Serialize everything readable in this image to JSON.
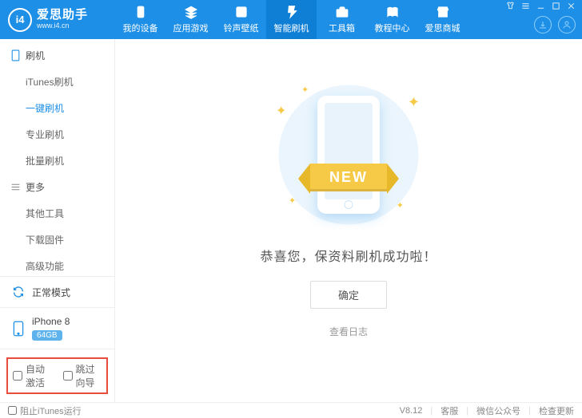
{
  "brand": {
    "name": "爱思助手",
    "site": "www.i4.cn",
    "logo_text": "i4"
  },
  "nav": [
    {
      "label": "我的设备",
      "icon": "device"
    },
    {
      "label": "应用游戏",
      "icon": "apps"
    },
    {
      "label": "铃声壁纸",
      "icon": "ring"
    },
    {
      "label": "智能刷机",
      "icon": "flash",
      "active": true
    },
    {
      "label": "工具箱",
      "icon": "toolbox"
    },
    {
      "label": "教程中心",
      "icon": "book"
    },
    {
      "label": "爱思商城",
      "icon": "store"
    }
  ],
  "sidebar": {
    "groups": [
      {
        "title": "刷机",
        "icon": "phone",
        "items": [
          {
            "label": "iTunes刷机"
          },
          {
            "label": "一键刷机",
            "active": true
          },
          {
            "label": "专业刷机"
          },
          {
            "label": "批量刷机"
          }
        ]
      },
      {
        "title": "更多",
        "icon": "menu",
        "items": [
          {
            "label": "其他工具"
          },
          {
            "label": "下载固件"
          },
          {
            "label": "高级功能"
          }
        ]
      }
    ]
  },
  "mode": {
    "label": "正常模式"
  },
  "device": {
    "name": "iPhone 8",
    "storage": "64GB"
  },
  "bottom_checks": {
    "auto_activate": "自动激活",
    "skip_setup": "跳过向导"
  },
  "main": {
    "ribbon_text": "NEW",
    "success_message": "恭喜您，保资料刷机成功啦！",
    "confirm": "确定",
    "view_log": "查看日志"
  },
  "status": {
    "block_itunes": "阻止iTunes运行",
    "version": "V8.12",
    "support": "客服",
    "wechat": "微信公众号",
    "update": "检查更新"
  }
}
